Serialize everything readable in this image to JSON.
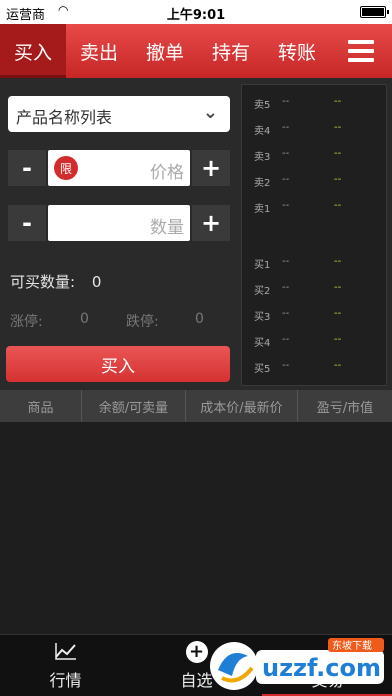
{
  "status_bar": {
    "carrier": "运营商",
    "time": "上午9:01"
  },
  "tabs": [
    {
      "label": "买入",
      "active": true
    },
    {
      "label": "卖出",
      "active": false
    },
    {
      "label": "撤单",
      "active": false
    },
    {
      "label": "持有",
      "active": false
    },
    {
      "label": "转账",
      "active": false
    }
  ],
  "form": {
    "product_select": "产品名称列表",
    "price_badge": "限",
    "price_placeholder": "价格",
    "quantity_placeholder": "数量",
    "minus": "-",
    "plus": "+",
    "buyable_label": "可买数量:",
    "buyable_value": "0",
    "limit_up_label": "涨停:",
    "limit_up_value": "0",
    "limit_down_label": "跌停:",
    "limit_down_value": "0",
    "submit": "买入"
  },
  "order_book": {
    "asks": [
      {
        "level": "卖5",
        "price": "--",
        "volume": "--"
      },
      {
        "level": "卖4",
        "price": "--",
        "volume": "--"
      },
      {
        "level": "卖3",
        "price": "--",
        "volume": "--"
      },
      {
        "level": "卖2",
        "price": "--",
        "volume": "--"
      },
      {
        "level": "卖1",
        "price": "--",
        "volume": "--"
      }
    ],
    "bids": [
      {
        "level": "买1",
        "price": "--",
        "volume": "--"
      },
      {
        "level": "买2",
        "price": "--",
        "volume": "--"
      },
      {
        "level": "买3",
        "price": "--",
        "volume": "--"
      },
      {
        "level": "买4",
        "price": "--",
        "volume": "--"
      },
      {
        "level": "买5",
        "price": "--",
        "volume": "--"
      }
    ]
  },
  "table_headers": [
    "商品",
    "余额/可卖量",
    "成本价/最新价",
    "盈亏/市值"
  ],
  "bottom_nav": [
    {
      "label": "行情",
      "icon": "chart-icon"
    },
    {
      "label": "自选",
      "icon": "add-circle-icon"
    },
    {
      "label": "交易",
      "icon": "trade-icon",
      "active": true
    }
  ],
  "watermark": {
    "text": "uzzf.com",
    "sub": "东坡下载"
  },
  "colors": {
    "accent": "#d22c2c",
    "ask_volume": "#cdd93a",
    "background": "#2a2a2a"
  }
}
